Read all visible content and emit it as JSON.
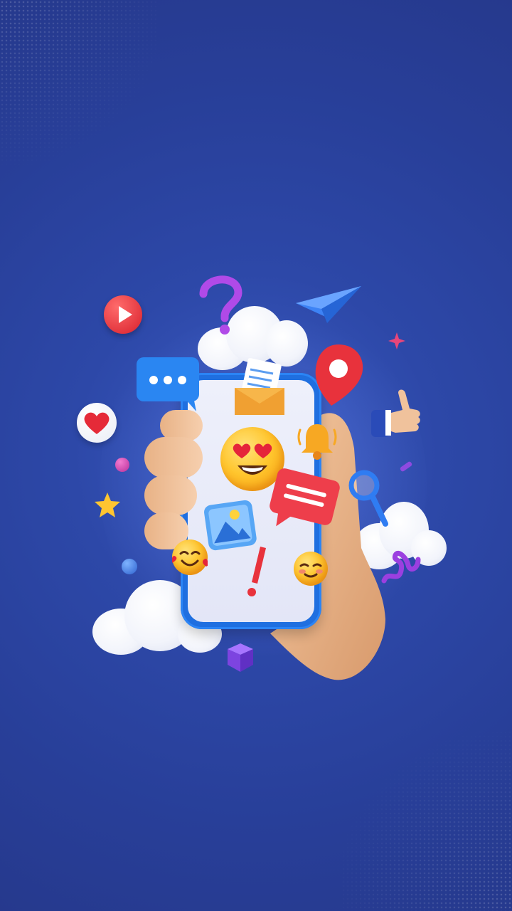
{
  "illustration": {
    "theme_colors": {
      "background": "#2a43a0",
      "phone_frame": "#1f6fe0",
      "accent_red": "#e8323c",
      "accent_purple": "#9b3fe0",
      "accent_blue": "#2f7cf2"
    },
    "icons": [
      "question-mark-icon",
      "paper-plane-icon",
      "play-button-icon",
      "star-icon",
      "chat-bubble-icon",
      "envelope-icon",
      "location-pin-icon",
      "thumbs-up-icon",
      "heart-icon",
      "heart-eyes-emoji-icon",
      "bell-icon",
      "image-icon",
      "message-bubble-icon",
      "magnifier-icon",
      "smiling-hearts-emoji-icon",
      "exclamation-icon",
      "blushing-emoji-icon",
      "spiral-ribbon-icon",
      "cube-icon"
    ]
  }
}
